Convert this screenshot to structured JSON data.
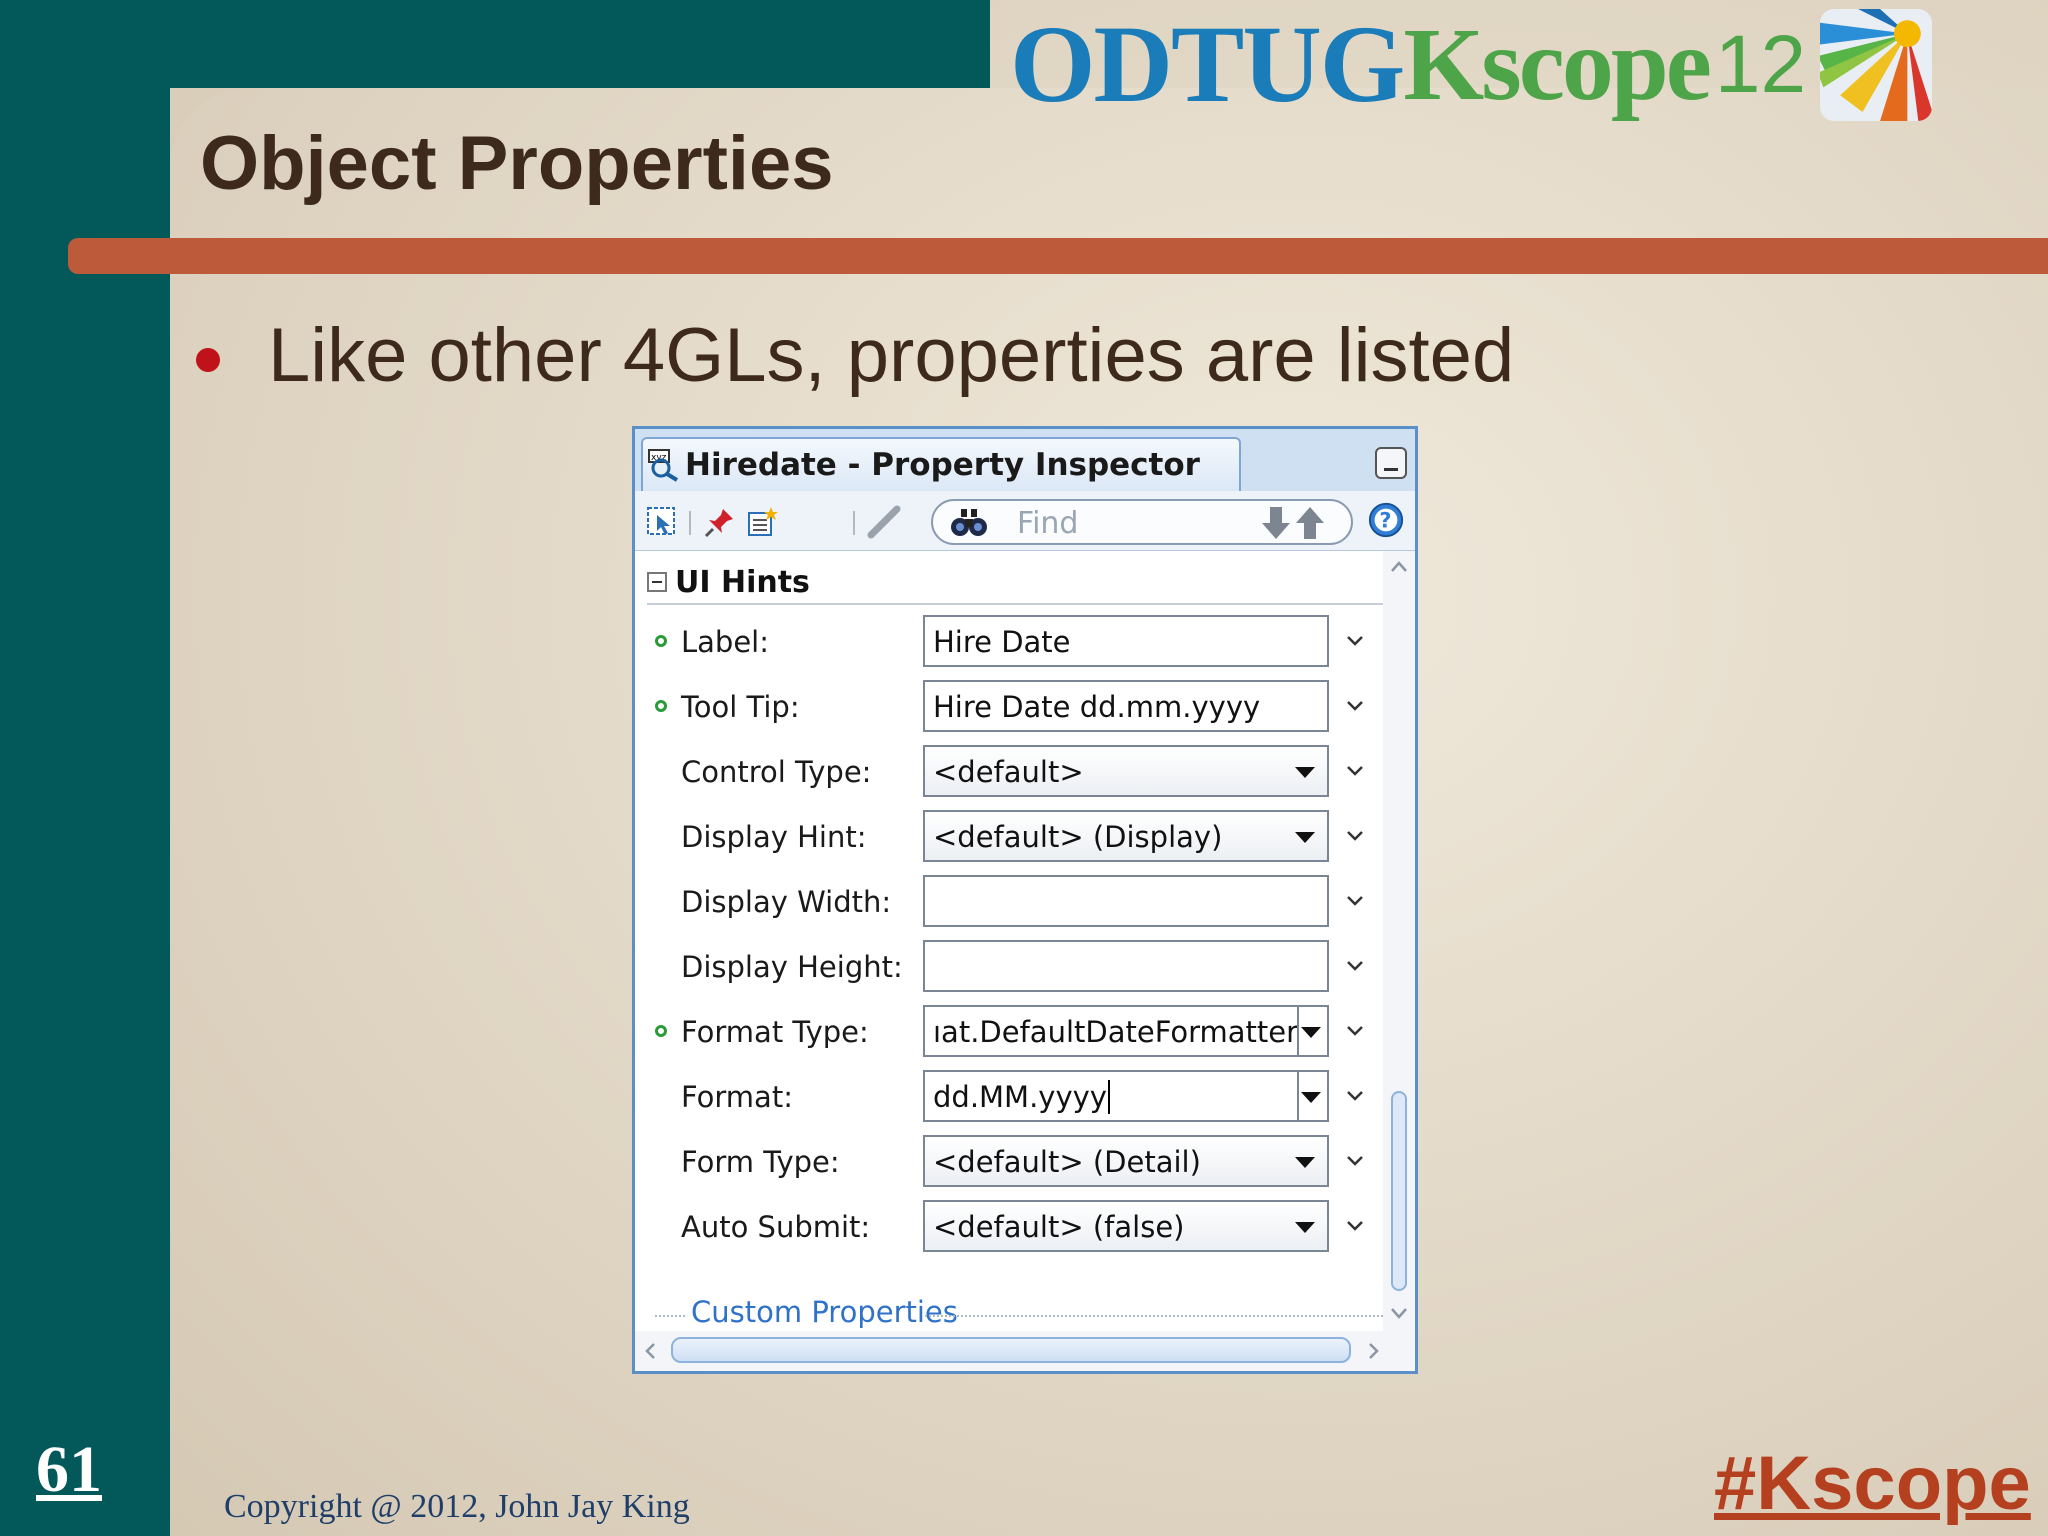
{
  "slide": {
    "title": "Object Properties",
    "bullet": "Like other 4GLs, properties are listed",
    "slide_number": "61",
    "copyright": "Copyright @ 2012, John Jay King",
    "hashtag": "#Kscope"
  },
  "logo": {
    "odtug": "ODTUG",
    "kscope": "Kscope",
    "year": "12"
  },
  "colors": {
    "teal_band": "#03595a",
    "rule": "#bc5a3a",
    "title_text": "#3d2a1c",
    "bullet_dot": "#c0121a",
    "odtug_blue": "#1a7cb8",
    "kscope_green": "#4ea449",
    "hashtag": "#b4401f",
    "link_blue": "#2f72c8"
  },
  "inspector": {
    "title": "Hiredate - Property Inspector",
    "find_placeholder": "Find",
    "toolbar_icons": [
      "select-icon",
      "pin-icon",
      "edit-properties-icon",
      "pencil-icon",
      "binoculars-icon",
      "arrow-down-icon",
      "arrow-up-icon",
      "help-icon"
    ],
    "section": "UI Hints",
    "properties": [
      {
        "label": "Label:",
        "value": "Hire Date",
        "type": "text",
        "bound": true
      },
      {
        "label": "Tool Tip:",
        "value": "Hire Date dd.mm.yyyy",
        "type": "text",
        "bound": true
      },
      {
        "label": "Control Type:",
        "value": "<default>",
        "type": "combo",
        "bound": false
      },
      {
        "label": "Display Hint:",
        "value": "<default> (Display)",
        "type": "combo",
        "bound": false
      },
      {
        "label": "Display Width:",
        "value": "",
        "type": "text",
        "bound": false
      },
      {
        "label": "Display Height:",
        "value": "",
        "type": "text",
        "bound": false
      },
      {
        "label": "Format Type:",
        "value": "ıat.DefaultDateFormatter",
        "type": "split",
        "bound": true
      },
      {
        "label": "Format:",
        "value": "dd.MM.yyyy",
        "type": "split",
        "bound": false
      },
      {
        "label": "Form Type:",
        "value": "<default> (Detail)",
        "type": "combo",
        "bound": false
      },
      {
        "label": "Auto Submit:",
        "value": "<default> (false)",
        "type": "combo",
        "bound": false
      }
    ],
    "custom_properties": "Custom Properties"
  }
}
